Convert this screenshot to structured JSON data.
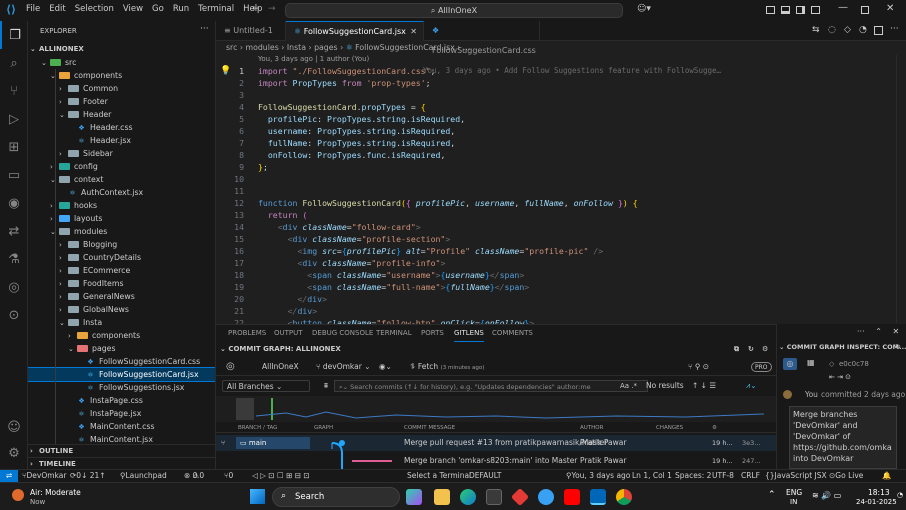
{
  "titlebar": {
    "menu": [
      "File",
      "Edit",
      "Selection",
      "View",
      "Go",
      "Run",
      "Terminal",
      "Help"
    ],
    "command_center": "AllInOneX"
  },
  "explorer": {
    "header": "EXPLORER",
    "root": "ALLINONEX",
    "rows": [
      {
        "label": "src",
        "depth": 1,
        "kind": "folder-open",
        "color": "#4caf50"
      },
      {
        "label": "components",
        "depth": 2,
        "kind": "folder-open",
        "color": "#e8a33c"
      },
      {
        "label": "Common",
        "depth": 3,
        "kind": "folder",
        "color": "#90a4ae"
      },
      {
        "label": "Footer",
        "depth": 3,
        "kind": "folder",
        "color": "#90a4ae"
      },
      {
        "label": "Header",
        "depth": 3,
        "kind": "folder-open",
        "color": "#90a4ae"
      },
      {
        "label": "Header.css",
        "depth": 4,
        "kind": "css"
      },
      {
        "label": "Header.jsx",
        "depth": 4,
        "kind": "jsx"
      },
      {
        "label": "Sidebar",
        "depth": 3,
        "kind": "folder",
        "color": "#90a4ae"
      },
      {
        "label": "config",
        "depth": 2,
        "kind": "folder",
        "color": "#26a69a"
      },
      {
        "label": "context",
        "depth": 2,
        "kind": "folder-open",
        "color": "#90a4ae"
      },
      {
        "label": "AuthContext.jsx",
        "depth": 3,
        "kind": "jsx"
      },
      {
        "label": "hooks",
        "depth": 2,
        "kind": "folder",
        "color": "#26a69a"
      },
      {
        "label": "layouts",
        "depth": 2,
        "kind": "folder",
        "color": "#42a5f5"
      },
      {
        "label": "modules",
        "depth": 2,
        "kind": "folder-open",
        "color": "#90a4ae"
      },
      {
        "label": "Blogging",
        "depth": 3,
        "kind": "folder",
        "color": "#90a4ae"
      },
      {
        "label": "CountryDetails",
        "depth": 3,
        "kind": "folder",
        "color": "#90a4ae"
      },
      {
        "label": "ECommerce",
        "depth": 3,
        "kind": "folder",
        "color": "#90a4ae"
      },
      {
        "label": "FoodItems",
        "depth": 3,
        "kind": "folder",
        "color": "#90a4ae"
      },
      {
        "label": "GeneralNews",
        "depth": 3,
        "kind": "folder",
        "color": "#90a4ae"
      },
      {
        "label": "GlobalNews",
        "depth": 3,
        "kind": "folder",
        "color": "#90a4ae"
      },
      {
        "label": "Insta",
        "depth": 3,
        "kind": "folder-open",
        "color": "#90a4ae"
      },
      {
        "label": "components",
        "depth": 4,
        "kind": "folder",
        "color": "#e8a33c"
      },
      {
        "label": "pages",
        "depth": 4,
        "kind": "folder-open",
        "color": "#e57373"
      },
      {
        "label": "FollowSuggestionCard.css",
        "depth": 5,
        "kind": "css"
      },
      {
        "label": "FollowSuggestionCard.jsx",
        "depth": 5,
        "kind": "jsx",
        "selected": true
      },
      {
        "label": "FollowSuggestions.jsx",
        "depth": 5,
        "kind": "jsx"
      },
      {
        "label": "InstaPage.css",
        "depth": 4,
        "kind": "css"
      },
      {
        "label": "InstaPage.jsx",
        "depth": 4,
        "kind": "jsx"
      },
      {
        "label": "MainContent.css",
        "depth": 4,
        "kind": "css"
      },
      {
        "label": "MainContent.jsx",
        "depth": 4,
        "kind": "jsx"
      }
    ],
    "sections": [
      "OUTLINE",
      "TIMELINE"
    ]
  },
  "tabs": [
    {
      "label": "Untitled-1",
      "active": false
    },
    {
      "label": "FollowSuggestionCard.jsx",
      "active": true
    },
    {
      "label": "FollowSuggestionCard.css",
      "active": false
    }
  ],
  "breadcrumb": [
    "src",
    "modules",
    "Insta",
    "pages",
    "FollowSuggestionCard.jsx",
    "..."
  ],
  "codelens": "You, 3 days ago | 1 author (You)",
  "blame": "You, 3 days ago • Add Follow Suggestions feature with FollowSugge…",
  "code_lines": [
    {
      "n": "1",
      "html": "<span class='k'>import</span> <span class='s'>\"./FollowSuggestionCard.css\"</span><span class='p'>;</span>"
    },
    {
      "n": "2",
      "html": "<span class='k'>import</span> <span class='v'>PropTypes</span> <span class='k'>from</span> <span class='s'>'prop-types'</span><span class='p'>;</span>"
    },
    {
      "n": "3",
      "html": ""
    },
    {
      "n": "4",
      "html": "<span class='f'>FollowSuggestionCard</span><span class='p'>.</span><span class='v'>propTypes</span> <span class='p'>=</span> <span class='br'>{</span>"
    },
    {
      "n": "5",
      "html": "  <span class='v'>profilePic</span><span class='p'>:</span> <span class='v'>PropTypes</span><span class='p'>.</span><span class='v'>string</span><span class='p'>.</span><span class='v'>isRequired</span><span class='p'>,</span>"
    },
    {
      "n": "6",
      "html": "  <span class='v'>username</span><span class='p'>:</span> <span class='v'>PropTypes</span><span class='p'>.</span><span class='v'>string</span><span class='p'>.</span><span class='v'>isRequired</span><span class='p'>,</span>"
    },
    {
      "n": "7",
      "html": "  <span class='v'>fullName</span><span class='p'>:</span> <span class='v'>PropTypes</span><span class='p'>.</span><span class='v'>string</span><span class='p'>.</span><span class='v'>isRequired</span><span class='p'>,</span>"
    },
    {
      "n": "8",
      "html": "  <span class='v'>onFollow</span><span class='p'>:</span> <span class='v'>PropTypes</span><span class='p'>.</span><span class='v'>func</span><span class='p'>.</span><span class='v'>isRequired</span><span class='p'>,</span>"
    },
    {
      "n": "9",
      "html": "<span class='br'>}</span><span class='p'>;</span>"
    },
    {
      "n": "10",
      "html": ""
    },
    {
      "n": "11",
      "html": ""
    },
    {
      "n": "12",
      "html": "<span class='tg'>function</span> <span class='f'>FollowSuggestionCard</span><span class='br'>(</span><span class='br2'>{</span> <span class='pm'>profilePic</span><span class='p'>,</span> <span class='pm'>username</span><span class='p'>,</span> <span class='pm'>fullName</span><span class='p'>,</span> <span class='pm'>onFollow</span> <span class='br2'>}</span><span class='br'>)</span> <span class='br'>{</span>"
    },
    {
      "n": "13",
      "html": "  <span class='k'>return</span> <span class='br2'>(</span>"
    },
    {
      "n": "14",
      "html": "    <span class='bl'>&lt;</span><span class='tg'>div</span> <span class='at'>className</span><span class='p'>=</span><span class='s'>\"follow-card\"</span><span class='bl'>&gt;</span>"
    },
    {
      "n": "15",
      "html": "      <span class='bl'>&lt;</span><span class='tg'>div</span> <span class='at'>className</span><span class='p'>=</span><span class='s'>\"profile-section\"</span><span class='bl'>&gt;</span>"
    },
    {
      "n": "16",
      "html": "        <span class='bl'>&lt;</span><span class='tg'>img</span> <span class='at'>src</span><span class='p'>=</span><span class='br3'>{</span><span class='pm'>profilePic</span><span class='br3'>}</span> <span class='at'>alt</span><span class='p'>=</span><span class='s'>\"Profile\"</span> <span class='at'>className</span><span class='p'>=</span><span class='s'>\"profile-pic\"</span> <span class='bl'>/&gt;</span>"
    },
    {
      "n": "17",
      "html": "        <span class='bl'>&lt;</span><span class='tg'>div</span> <span class='at'>className</span><span class='p'>=</span><span class='s'>\"profile-info\"</span><span class='bl'>&gt;</span>"
    },
    {
      "n": "18",
      "html": "          <span class='bl'>&lt;</span><span class='tg'>span</span> <span class='at'>className</span><span class='p'>=</span><span class='s'>\"username\"</span><span class='bl'>&gt;</span><span class='br3'>{</span><span class='pm'>username</span><span class='br3'>}</span><span class='bl'>&lt;/</span><span class='tg'>span</span><span class='bl'>&gt;</span>"
    },
    {
      "n": "19",
      "html": "          <span class='bl'>&lt;</span><span class='tg'>span</span> <span class='at'>className</span><span class='p'>=</span><span class='s'>\"full-name\"</span><span class='bl'>&gt;</span><span class='br3'>{</span><span class='pm'>fullName</span><span class='br3'>}</span><span class='bl'>&lt;/</span><span class='tg'>span</span><span class='bl'>&gt;</span>"
    },
    {
      "n": "20",
      "html": "        <span class='bl'>&lt;/</span><span class='tg'>div</span><span class='bl'>&gt;</span>"
    },
    {
      "n": "21",
      "html": "      <span class='bl'>&lt;/</span><span class='tg'>div</span><span class='bl'>&gt;</span>"
    },
    {
      "n": "22",
      "html": "      <span class='bl'>&lt;</span><span class='tg'>button</span> <span class='at'>className</span><span class='p'>=</span><span class='s'>\"follow-btn\"</span> <span class='at'>onClick</span><span class='p'>=</span><span class='br3'>{</span><span class='pm'>onFollow</span><span class='br3'>}</span><span class='bl'>&gt;</span>"
    }
  ],
  "panel": {
    "tabs": [
      "PROBLEMS",
      "OUTPUT",
      "DEBUG CONSOLE",
      "TERMINAL",
      "PORTS",
      "GITLENS",
      "COMMENTS"
    ],
    "active_tab": "GITLENS",
    "commit_graph_title": "COMMIT GRAPH: ALLINONEX",
    "repo": "AllInOneX",
    "branch": "devOmkar",
    "fetch_label": "Fetch",
    "fetch_time": "(3 minutes ago)",
    "branches_dropdown": "All Branches",
    "search_placeholder": "Search commits (↑↓ for history), e.g. \"Updates dependencies\" author:me",
    "no_results": "No results",
    "pro_badge": "PRO",
    "columns": [
      "BRANCH / TAG",
      "GRAPH",
      "COMMIT MESSAGE",
      "AUTHOR",
      "CHANGES",
      "DATE / TIME"
    ],
    "rows": [
      {
        "branch": "main",
        "message": "Merge pull request #13 from pratikpawarnasik/Master",
        "author": "Pratik Pawar",
        "date": "19 h...",
        "sha": "3e3..."
      },
      {
        "branch": "",
        "message": "Merge branch 'omkar-s8203:main' into Master",
        "author": "Pratik Pawar",
        "date": "19 h...",
        "sha": "247..."
      }
    ]
  },
  "inspect": {
    "title": "COMMIT GRAPH INSPECT: COM...",
    "sha": "e0c0c78",
    "author": "You",
    "when": "committed 2 days ago",
    "message": "Merge branches 'DevOmkar' and 'DevOmkar' of https://github.com/omka into DevOmkar"
  },
  "statusbar": {
    "branch": "DevOmkar",
    "sync": "0↓ 21↑",
    "launchpad": "Launchpad",
    "errors": "0",
    "warnings": "0",
    "ports": "0",
    "select_terminal": "Select a Terminal",
    "profile": "DEFAULT",
    "blame": "You, 3 days ago",
    "position": "Ln 1, Col 1",
    "spaces": "Spaces: 2",
    "encoding": "UTF-8",
    "eol": "CRLF",
    "language": "JavaScript JSX",
    "golive": "Go Live"
  },
  "taskbar": {
    "weather_title": "Air: Moderate",
    "weather_sub": "Now",
    "search": "Search",
    "lang": "ENG",
    "region": "IN",
    "time": "18:13",
    "date": "24-01-2025"
  }
}
